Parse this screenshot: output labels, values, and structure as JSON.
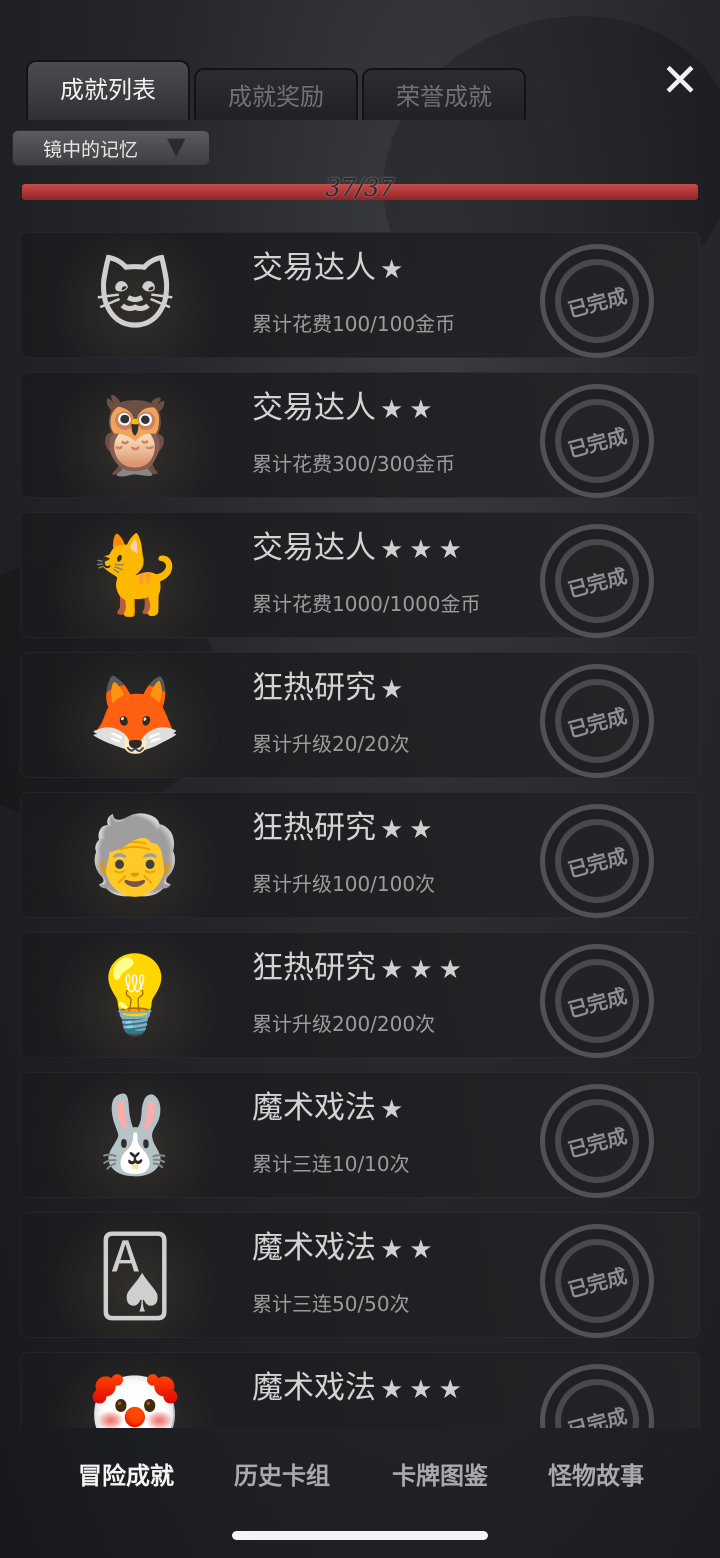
{
  "tabs": [
    {
      "label": "成就列表",
      "active": true
    },
    {
      "label": "成就奖励",
      "active": false
    },
    {
      "label": "荣誉成就",
      "active": false
    }
  ],
  "close_icon": "close-icon",
  "filter": {
    "label": "镜中的记忆",
    "icon": "chevron-down-icon"
  },
  "progress": {
    "text": "37/37",
    "fraction": 1.0
  },
  "achievements": [
    {
      "title": "交易达人",
      "stars": "★",
      "desc": "累计花费100/100金币",
      "status": "已完成",
      "portrait": "🐱"
    },
    {
      "title": "交易达人",
      "stars": "★★",
      "desc": "累计花费300/300金币",
      "status": "已完成",
      "portrait": "🦉"
    },
    {
      "title": "交易达人",
      "stars": "★★★",
      "desc": "累计花费1000/1000金币",
      "status": "已完成",
      "portrait": "🐈"
    },
    {
      "title": "狂热研究",
      "stars": "★",
      "desc": "累计升级20/20次",
      "status": "已完成",
      "portrait": "🦊"
    },
    {
      "title": "狂热研究",
      "stars": "★★",
      "desc": "累计升级100/100次",
      "status": "已完成",
      "portrait": "🧓"
    },
    {
      "title": "狂热研究",
      "stars": "★★★",
      "desc": "累计升级200/200次",
      "status": "已完成",
      "portrait": "💡"
    },
    {
      "title": "魔术戏法",
      "stars": "★",
      "desc": "累计三连10/10次",
      "status": "已完成",
      "portrait": "🐰"
    },
    {
      "title": "魔术戏法",
      "stars": "★★",
      "desc": "累计三连50/50次",
      "status": "已完成",
      "portrait": "🂡"
    },
    {
      "title": "魔术戏法",
      "stars": "★★★",
      "desc": "",
      "status": "已完成",
      "portrait": "🤡"
    }
  ],
  "bottom_nav": [
    {
      "label": "冒险成就",
      "active": true
    },
    {
      "label": "历史卡组",
      "active": false
    },
    {
      "label": "卡牌图鉴",
      "active": false
    },
    {
      "label": "怪物故事",
      "active": false
    }
  ]
}
